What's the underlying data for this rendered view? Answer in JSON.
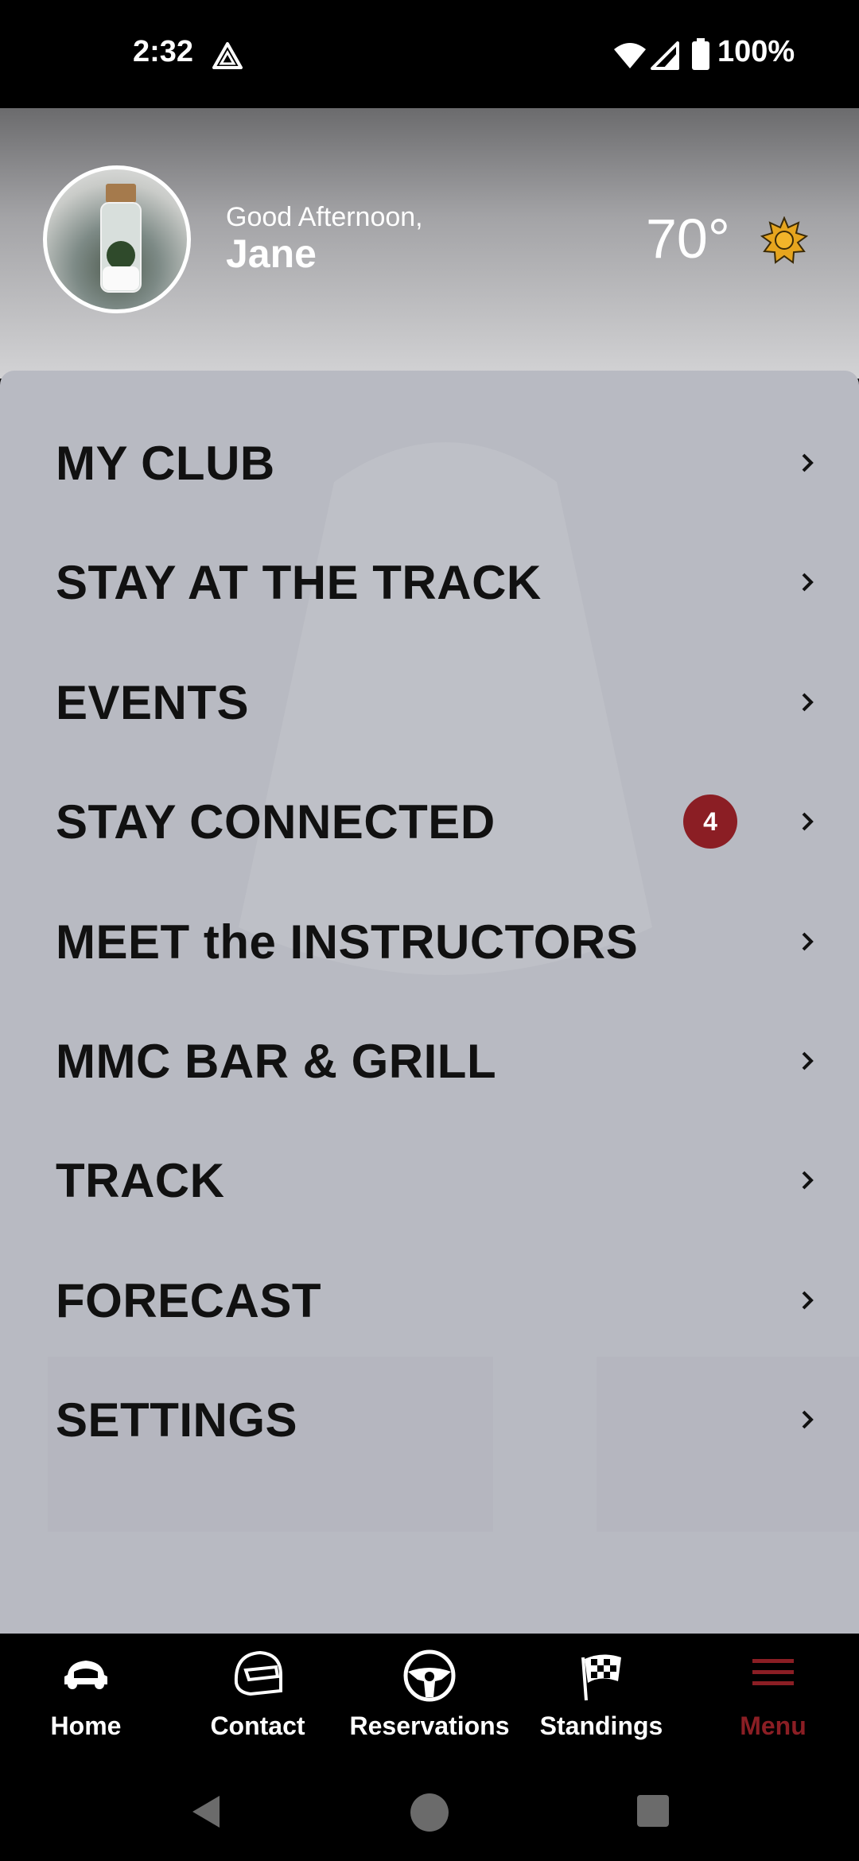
{
  "status_bar": {
    "time": "2:32",
    "battery": "100%"
  },
  "header": {
    "greeting": "Good Afternoon,",
    "name": "Jane",
    "temperature": "70°",
    "weather_icon": "sun-icon"
  },
  "menu": {
    "items": [
      {
        "label": "MY CLUB"
      },
      {
        "label": "STAY AT THE TRACK"
      },
      {
        "label": "EVENTS"
      },
      {
        "label": "STAY CONNECTED",
        "badge": "4"
      },
      {
        "label": "MEET the INSTRUCTORS"
      },
      {
        "label": "MMC BAR & GRILL"
      },
      {
        "label": "TRACK"
      },
      {
        "label": "FORECAST"
      },
      {
        "label": "SETTINGS"
      }
    ]
  },
  "bottom_nav": {
    "tabs": [
      {
        "label": "Home",
        "icon": "car-icon"
      },
      {
        "label": "Contact",
        "icon": "helmet-icon"
      },
      {
        "label": "Reservations",
        "icon": "steering-wheel-icon"
      },
      {
        "label": "Standings",
        "icon": "checkered-flag-icon"
      },
      {
        "label": "Menu",
        "icon": "hamburger-menu-icon",
        "active": true
      }
    ]
  },
  "colors": {
    "accent": "#8b1e24",
    "panel": "#b8bac2",
    "header_top": "#6b6b6d",
    "nav_background": "#000000"
  }
}
